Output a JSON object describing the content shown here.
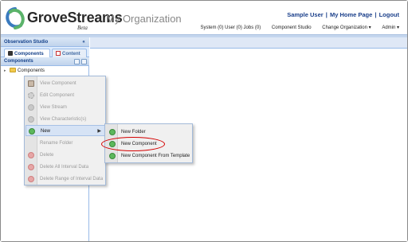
{
  "header": {
    "brand": "GroveStreams",
    "beta": "Beta",
    "org_name": "My Organization",
    "user_links": [
      "Sample User",
      "My Home Page",
      "Logout"
    ],
    "nav": [
      "System (0) User (0) Jobs (0)",
      "Component Studio",
      "Change Organization ▾",
      "Admin ▾"
    ]
  },
  "left_panel": {
    "title": "Observation Studio",
    "collapse": "«",
    "tabs": [
      {
        "label": "Components",
        "active": true
      },
      {
        "label": "Content",
        "active": false
      }
    ],
    "section_title": "Components",
    "tree_root": "Components"
  },
  "context_menu": {
    "items": [
      {
        "label": "View Component",
        "enabled": false,
        "icon": "component-icon"
      },
      {
        "label": "Edit Component",
        "enabled": false,
        "icon": "gear-icon"
      },
      {
        "label": "View Stream",
        "enabled": false,
        "icon": "stream-icon"
      },
      {
        "label": "View Characteristic(s)",
        "enabled": false,
        "icon": "characteristic-icon"
      },
      {
        "label": "New",
        "enabled": true,
        "active": true,
        "icon": "add-icon"
      },
      {
        "label": "Rename Folder",
        "enabled": false,
        "icon": ""
      },
      {
        "label": "Delete",
        "enabled": false,
        "icon": "delete-icon"
      },
      {
        "label": "Delete All Interval Data",
        "enabled": false,
        "icon": "delete-icon"
      },
      {
        "label": "Delete Range of Interval Data",
        "enabled": false,
        "icon": "delete-icon"
      }
    ]
  },
  "sub_menu": {
    "items": [
      {
        "label": "New Folder",
        "icon": "add-icon"
      },
      {
        "label": "New Component",
        "icon": "add-icon"
      },
      {
        "label": "New Component From Template",
        "icon": "add-icon"
      }
    ]
  },
  "colors": {
    "accent": "#15428b",
    "panel_blue": "#dfe8f6",
    "highlight_ring": "#d40000"
  }
}
